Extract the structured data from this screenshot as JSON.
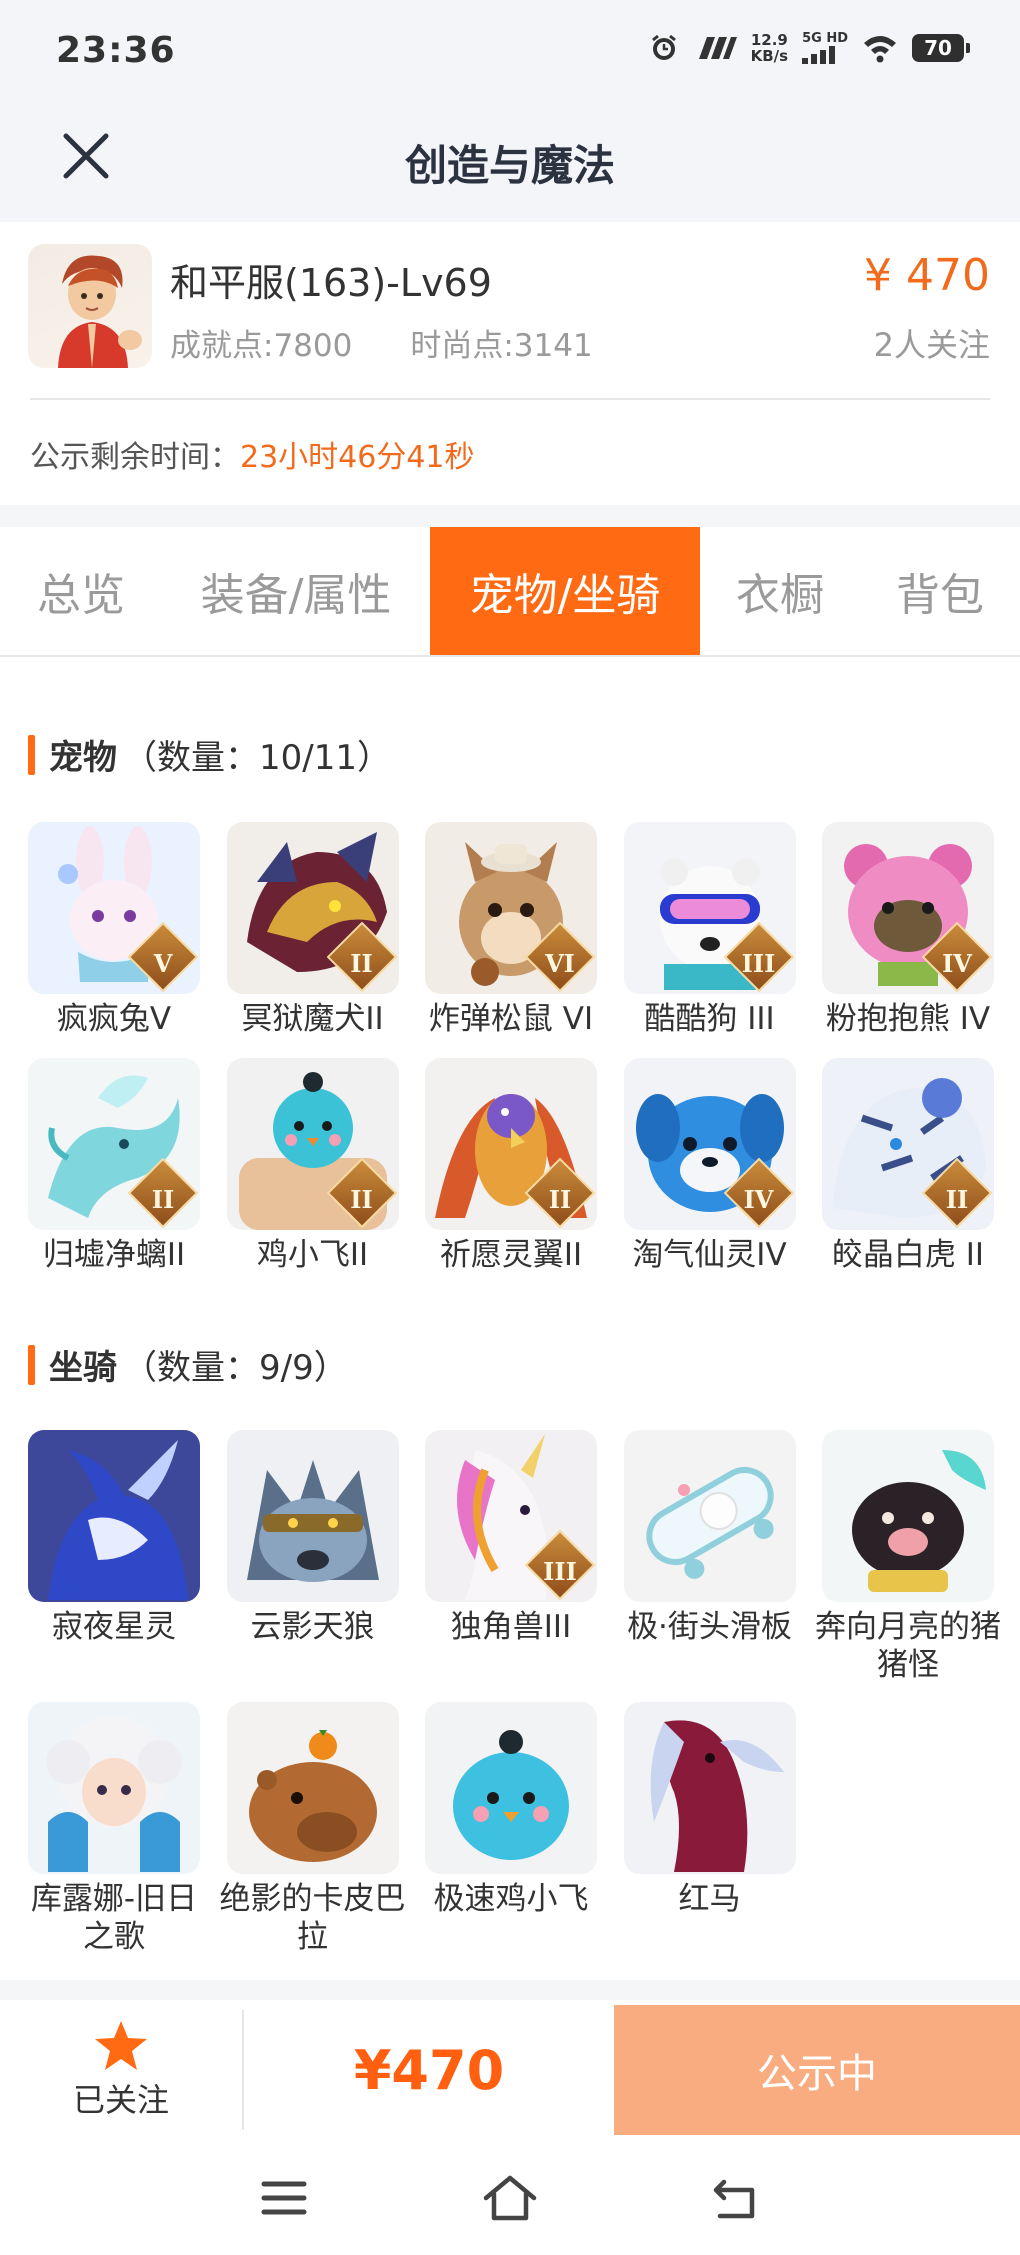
{
  "status_bar": {
    "time": "23:36",
    "speed_value": "12.9",
    "speed_unit": "KB/s",
    "network": "5G HD",
    "battery": "70"
  },
  "header": {
    "title": "创造与魔法"
  },
  "account": {
    "name": "和平服(163)-Lv69",
    "achievement": "成就点:7800",
    "fashion": "时尚点:3141",
    "price": "¥ 470",
    "followers": "2人关注",
    "countdown_label": "公示剩余时间：",
    "countdown_value": "23小时46分41秒"
  },
  "tabs": [
    {
      "label": "总览",
      "active": false
    },
    {
      "label": "装备/属性",
      "active": false
    },
    {
      "label": "宠物/坐骑",
      "active": true
    },
    {
      "label": "衣橱",
      "active": false
    },
    {
      "label": "背包",
      "active": false
    }
  ],
  "pets": {
    "title": "宠物",
    "count": "（数量：10/11）",
    "items": [
      {
        "name": "疯疯兔V",
        "badge": "V",
        "icon": "rabbit-icon"
      },
      {
        "name": "冥狱魔犬II",
        "badge": "II",
        "icon": "demon-dog-icon"
      },
      {
        "name": "炸弹松鼠 VI",
        "badge": "VI",
        "icon": "squirrel-icon"
      },
      {
        "name": "酷酷狗 III",
        "badge": "III",
        "icon": "goggle-dog-icon"
      },
      {
        "name": "粉抱抱熊 IV",
        "badge": "IV",
        "icon": "pink-bear-icon"
      },
      {
        "name": "归墟净螭II",
        "badge": "II",
        "icon": "dragon-icon"
      },
      {
        "name": "鸡小飞II",
        "badge": "II",
        "icon": "chick-icon"
      },
      {
        "name": "祈愿灵翼II",
        "badge": "II",
        "icon": "phoenix-icon"
      },
      {
        "name": "淘气仙灵IV",
        "badge": "IV",
        "icon": "fairy-dog-icon"
      },
      {
        "name": "皎晶白虎 II",
        "badge": "II",
        "icon": "white-tiger-icon"
      }
    ]
  },
  "mounts": {
    "title": "坐骑",
    "count": "（数量：9/9）",
    "items": [
      {
        "name": "寂夜星灵",
        "badge": "",
        "icon": "night-deer-icon"
      },
      {
        "name": "云影天狼",
        "badge": "",
        "icon": "wolf-icon"
      },
      {
        "name": "独角兽III",
        "badge": "III",
        "icon": "unicorn-icon"
      },
      {
        "name": "极·街头滑板",
        "badge": "",
        "icon": "skateboard-icon"
      },
      {
        "name": "奔向月亮的猪猪怪",
        "badge": "",
        "icon": "pig-icon"
      },
      {
        "name": "库露娜-旧日之歌",
        "badge": "",
        "icon": "sheep-girl-icon"
      },
      {
        "name": "绝影的卡皮巴拉",
        "badge": "",
        "icon": "capybara-icon"
      },
      {
        "name": "极速鸡小飞",
        "badge": "",
        "icon": "blue-chick-icon"
      },
      {
        "name": "红马",
        "badge": "",
        "icon": "red-horse-icon"
      }
    ]
  },
  "bottom_bar": {
    "follow_label": "已关注",
    "price": "¥470",
    "status_button": "公示中"
  },
  "colors": {
    "accent": "#ff6a13",
    "price": "#f26b1d",
    "disabled_button": "#f9ac80"
  }
}
